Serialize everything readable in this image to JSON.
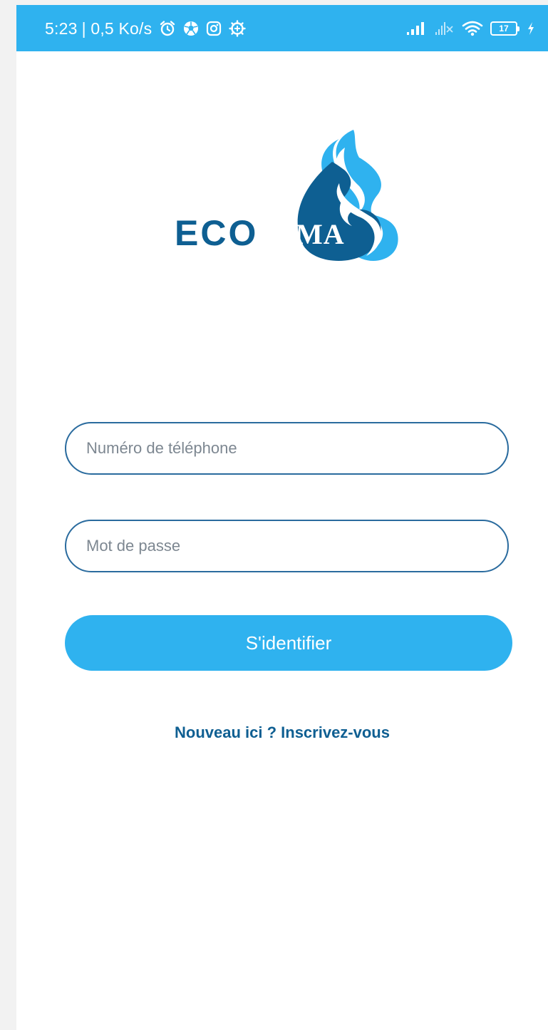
{
  "status_bar": {
    "time": "5:23",
    "speed": "| 0,5 Ko/s",
    "left_icons": [
      "alarm-icon",
      "soccer-ball-icon",
      "instagram-icon",
      "settings-icon"
    ],
    "right_icons": [
      "signal-icon",
      "no-signal-icon",
      "wifi-icon",
      "battery-icon",
      "charging-icon"
    ],
    "battery_level": "17"
  },
  "logo": {
    "text_left": "ECO",
    "text_right": "MA",
    "color_dark": "#0e5f92",
    "color_light": "#2fb2ef"
  },
  "form": {
    "phone_placeholder": "Numéro de téléphone",
    "phone_value": "",
    "password_placeholder": "Mot de passe",
    "password_value": "",
    "submit_label": "S'identifier"
  },
  "signup": {
    "label": "Nouveau ici ? Inscrivez-vous"
  },
  "colors": {
    "accent": "#2fb2ef",
    "dark_blue": "#0f5f92",
    "field_border": "#2a6b9e"
  }
}
